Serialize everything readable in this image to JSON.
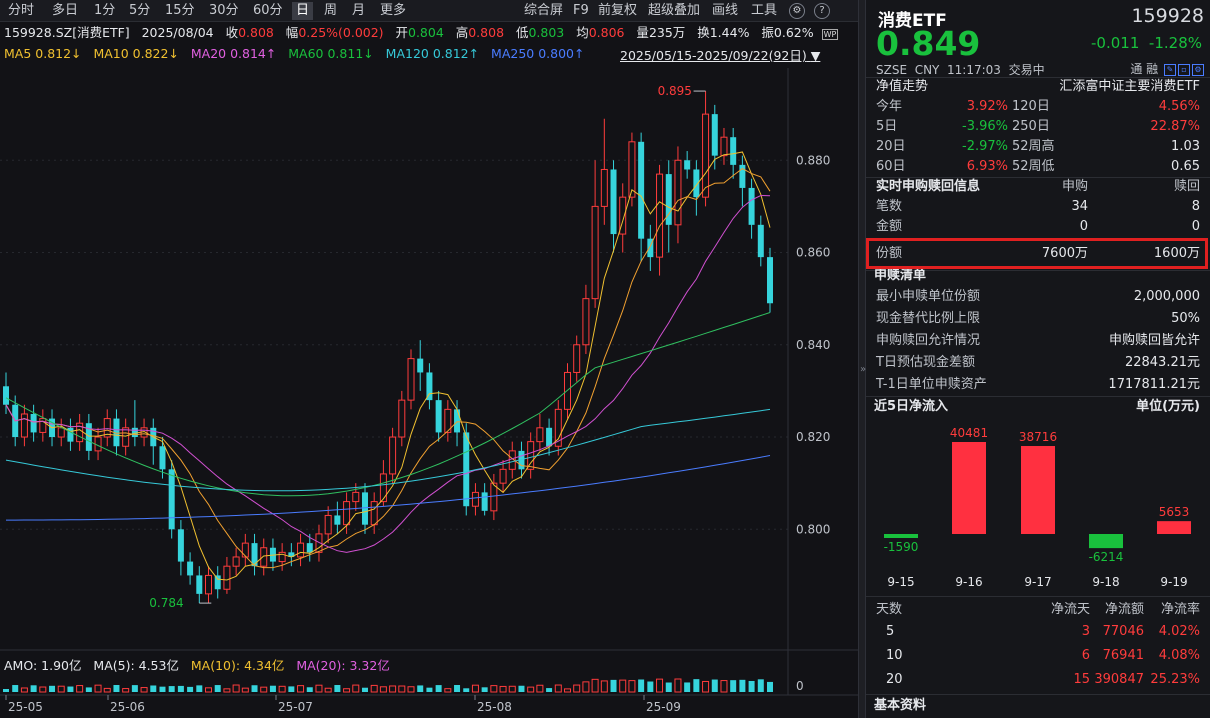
{
  "toolbar": {
    "periods": [
      "分时",
      "多日",
      "1分",
      "5分",
      "15分",
      "30分",
      "60分",
      "日",
      "周",
      "月",
      "更多"
    ],
    "active_period": "日",
    "right_items": [
      "综合屏",
      "F9",
      "前复权",
      "超级叠加",
      "画线",
      "工具"
    ],
    "settings_icon": "gear-icon",
    "help_icon": "help-icon"
  },
  "ohlc_bar": {
    "code_name": "159928.SZ[消费ETF]",
    "date": "2025/08/04",
    "close_label": "收",
    "close": "0.808",
    "amp_label": "幅",
    "amp": "0.25%(0.002)",
    "open_label": "开",
    "open": "0.804",
    "high_label": "高",
    "high": "0.808",
    "low_label": "低",
    "low": "0.803",
    "avg_label": "均",
    "avg": "0.806",
    "vol_label": "量",
    "vol": "235万",
    "turnover_label": "换",
    "turnover": "1.44%",
    "swing_label": "振",
    "swing": "0.62%",
    "badge": "WP"
  },
  "ma_bar": {
    "ma5": "MA5 0.812↓",
    "ma10": "MA10 0.822↓",
    "ma20": "MA20 0.814↑",
    "ma60": "MA60 0.811↓",
    "ma120": "MA120 0.812↑",
    "ma250": "MA250 0.800↑",
    "date_range": "2025/05/15-2025/09/22(92日)"
  },
  "chart_data": {
    "type": "candlestick",
    "y_ticks": [
      "0.880",
      "0.860",
      "0.840",
      "0.820",
      "0.800"
    ],
    "y_tick_values": [
      0.88,
      0.86,
      0.84,
      0.82,
      0.8
    ],
    "x_ticks": [
      "25-05",
      "25-06",
      "25-07",
      "25-08",
      "25-09"
    ],
    "high_annotation": "0.895",
    "low_annotation": "0.784",
    "volume_zero_label": "0",
    "candles": [
      [
        0.831,
        0.827,
        0.834,
        0.825
      ],
      [
        0.827,
        0.82,
        0.829,
        0.818
      ],
      [
        0.82,
        0.825,
        0.827,
        0.818
      ],
      [
        0.825,
        0.821,
        0.827,
        0.819
      ],
      [
        0.821,
        0.824,
        0.826,
        0.819
      ],
      [
        0.824,
        0.82,
        0.826,
        0.818
      ],
      [
        0.82,
        0.822,
        0.824,
        0.818
      ],
      [
        0.822,
        0.819,
        0.824,
        0.817
      ],
      [
        0.819,
        0.823,
        0.825,
        0.817
      ],
      [
        0.823,
        0.817,
        0.825,
        0.815
      ],
      [
        0.817,
        0.82,
        0.822,
        0.815
      ],
      [
        0.82,
        0.824,
        0.826,
        0.818
      ],
      [
        0.824,
        0.818,
        0.826,
        0.816
      ],
      [
        0.818,
        0.822,
        0.824,
        0.816
      ],
      [
        0.822,
        0.82,
        0.828,
        0.818
      ],
      [
        0.82,
        0.822,
        0.824,
        0.818
      ],
      [
        0.822,
        0.818,
        0.824,
        0.814
      ],
      [
        0.818,
        0.813,
        0.82,
        0.811
      ],
      [
        0.813,
        0.8,
        0.815,
        0.798
      ],
      [
        0.8,
        0.793,
        0.802,
        0.79
      ],
      [
        0.793,
        0.79,
        0.795,
        0.788
      ],
      [
        0.79,
        0.786,
        0.792,
        0.784
      ],
      [
        0.786,
        0.79,
        0.792,
        0.784
      ],
      [
        0.79,
        0.787,
        0.792,
        0.785
      ],
      [
        0.787,
        0.792,
        0.794,
        0.786
      ],
      [
        0.792,
        0.794,
        0.796,
        0.79
      ],
      [
        0.794,
        0.797,
        0.799,
        0.792
      ],
      [
        0.797,
        0.792,
        0.799,
        0.79
      ],
      [
        0.792,
        0.796,
        0.798,
        0.79
      ],
      [
        0.796,
        0.793,
        0.798,
        0.791
      ],
      [
        0.793,
        0.795,
        0.797,
        0.791
      ],
      [
        0.795,
        0.794,
        0.797,
        0.792
      ],
      [
        0.794,
        0.797,
        0.799,
        0.792
      ],
      [
        0.797,
        0.795,
        0.799,
        0.793
      ],
      [
        0.795,
        0.799,
        0.801,
        0.793
      ],
      [
        0.799,
        0.803,
        0.805,
        0.797
      ],
      [
        0.803,
        0.801,
        0.806,
        0.799
      ],
      [
        0.801,
        0.806,
        0.808,
        0.799
      ],
      [
        0.806,
        0.808,
        0.81,
        0.804
      ],
      [
        0.808,
        0.801,
        0.81,
        0.799
      ],
      [
        0.801,
        0.806,
        0.808,
        0.799
      ],
      [
        0.806,
        0.812,
        0.815,
        0.805
      ],
      [
        0.812,
        0.82,
        0.822,
        0.81
      ],
      [
        0.82,
        0.828,
        0.83,
        0.818
      ],
      [
        0.828,
        0.837,
        0.839,
        0.826
      ],
      [
        0.837,
        0.834,
        0.841,
        0.83
      ],
      [
        0.834,
        0.828,
        0.836,
        0.826
      ],
      [
        0.828,
        0.821,
        0.83,
        0.819
      ],
      [
        0.821,
        0.826,
        0.828,
        0.819
      ],
      [
        0.826,
        0.821,
        0.828,
        0.818
      ],
      [
        0.821,
        0.805,
        0.823,
        0.803
      ],
      [
        0.805,
        0.808,
        0.81,
        0.803
      ],
      [
        0.808,
        0.804,
        0.81,
        0.803
      ],
      [
        0.804,
        0.81,
        0.812,
        0.802
      ],
      [
        0.81,
        0.813,
        0.815,
        0.808
      ],
      [
        0.813,
        0.817,
        0.819,
        0.811
      ],
      [
        0.817,
        0.813,
        0.819,
        0.811
      ],
      [
        0.813,
        0.819,
        0.821,
        0.811
      ],
      [
        0.819,
        0.822,
        0.825,
        0.817
      ],
      [
        0.822,
        0.818,
        0.824,
        0.816
      ],
      [
        0.818,
        0.826,
        0.828,
        0.816
      ],
      [
        0.826,
        0.834,
        0.836,
        0.824
      ],
      [
        0.834,
        0.84,
        0.842,
        0.832
      ],
      [
        0.84,
        0.85,
        0.853,
        0.838
      ],
      [
        0.85,
        0.87,
        0.88,
        0.848
      ],
      [
        0.87,
        0.878,
        0.889,
        0.866
      ],
      [
        0.878,
        0.864,
        0.88,
        0.86
      ],
      [
        0.864,
        0.872,
        0.875,
        0.86
      ],
      [
        0.872,
        0.884,
        0.886,
        0.87
      ],
      [
        0.884,
        0.863,
        0.886,
        0.858
      ],
      [
        0.863,
        0.859,
        0.866,
        0.856
      ],
      [
        0.859,
        0.877,
        0.879,
        0.855
      ],
      [
        0.877,
        0.866,
        0.88,
        0.86
      ],
      [
        0.866,
        0.88,
        0.883,
        0.862
      ],
      [
        0.88,
        0.878,
        0.882,
        0.876
      ],
      [
        0.878,
        0.872,
        0.88,
        0.868
      ],
      [
        0.872,
        0.89,
        0.895,
        0.87
      ],
      [
        0.89,
        0.881,
        0.892,
        0.878
      ],
      [
        0.881,
        0.885,
        0.887,
        0.879
      ],
      [
        0.885,
        0.879,
        0.887,
        0.876
      ],
      [
        0.879,
        0.874,
        0.881,
        0.87
      ],
      [
        0.874,
        0.866,
        0.876,
        0.863
      ],
      [
        0.866,
        0.859,
        0.868,
        0.857
      ],
      [
        0.859,
        0.849,
        0.861,
        0.847
      ]
    ],
    "ma_series": [
      {
        "name": "MA5",
        "color": "#f0c030"
      },
      {
        "name": "MA10",
        "color": "#f0a030"
      },
      {
        "name": "MA20",
        "color": "#d050d0"
      },
      {
        "name": "MA60",
        "color": "#30c060"
      },
      {
        "name": "MA120",
        "color": "#36c9d8"
      },
      {
        "name": "MA250",
        "color": "#4a7cff"
      }
    ]
  },
  "amo_bar": {
    "amo": "AMO: 1.90亿",
    "ma5": "MA(5): 4.53亿",
    "ma10": "MA(10): 4.34亿",
    "ma20": "MA(20): 3.32亿"
  },
  "quote": {
    "name": "消费ETF",
    "code": "159928",
    "price": "0.849",
    "change": "-0.011",
    "change_pct": "-1.28%",
    "exchange": "SZSE",
    "currency": "CNY",
    "time": "11:17:03",
    "status": "交易中",
    "tong": "通",
    "zhao": "融"
  },
  "nav": {
    "title": "净值走势",
    "fund_name": "汇添富中证主要消费ETF",
    "rows": [
      {
        "l1": "今年",
        "v1": "3.92%",
        "c1": "red",
        "l2": "120日",
        "v2": "4.56%",
        "c2": "red"
      },
      {
        "l1": "5日",
        "v1": "-3.96%",
        "c1": "green",
        "l2": "250日",
        "v2": "22.87%",
        "c2": "red"
      },
      {
        "l1": "20日",
        "v1": "-2.97%",
        "c1": "green",
        "l2": "52周高",
        "v2": "1.03",
        "c2": "white"
      },
      {
        "l1": "60日",
        "v1": "6.93%",
        "c1": "red",
        "l2": "52周低",
        "v2": "0.65",
        "c2": "white"
      }
    ]
  },
  "subscribe": {
    "title": "实时申购赎回信息",
    "col1": "申购",
    "col2": "赎回",
    "rows": [
      {
        "label": "笔数",
        "v1": "34",
        "v2": "8"
      },
      {
        "label": "金额",
        "v1": "0",
        "v2": "0"
      },
      {
        "label": "份额",
        "v1": "7600万",
        "v2": "1600万"
      }
    ]
  },
  "redemption_list": {
    "title": "申赎清单",
    "rows": [
      {
        "label": "最小申赎单位份额",
        "value": "2,000,000"
      },
      {
        "label": "现金替代比例上限",
        "value": "50%"
      },
      {
        "label": "申购赎回允许情况",
        "value": "申购赎回皆允许"
      },
      {
        "label": "T日预估现金差额",
        "value": "22843.21元"
      },
      {
        "label": "T-1日单位申赎资产",
        "value": "1717811.21元"
      }
    ]
  },
  "net_inflow": {
    "title": "近5日净流入",
    "unit": "单位(万元)",
    "chart_data": {
      "type": "bar",
      "categories": [
        "9-15",
        "9-16",
        "9-17",
        "9-18",
        "9-19"
      ],
      "values": [
        -1590,
        40481,
        38716,
        -6214,
        5653
      ],
      "value_labels": [
        "-1590",
        "40481",
        "38716",
        "-6214",
        "5653"
      ]
    },
    "table_headers": [
      "天数",
      "净流天",
      "净流额",
      "净流率"
    ],
    "table_rows": [
      [
        "5",
        "3",
        "77046",
        "4.02%"
      ],
      [
        "10",
        "6",
        "76941",
        "4.08%"
      ],
      [
        "20",
        "15",
        "390847",
        "25.23%"
      ]
    ]
  },
  "footer": {
    "basic_info": "基本资料"
  },
  "colors": {
    "up": "#ff3c3c",
    "down": "#36d4dc",
    "green": "#19c13d",
    "highlight_box": "#e02020"
  }
}
